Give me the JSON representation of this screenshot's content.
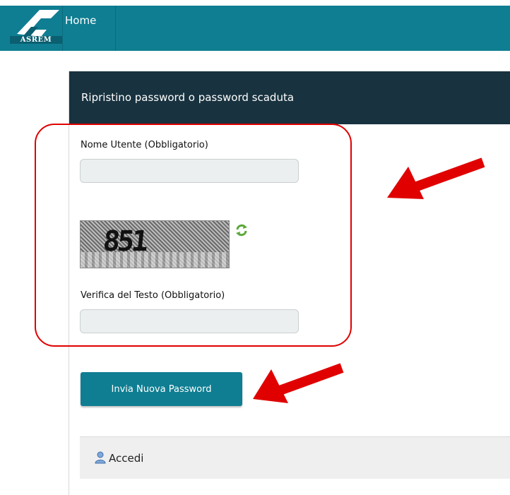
{
  "header": {
    "logo_text": "ASREM",
    "nav_home": "Home"
  },
  "panel": {
    "title": "Ripristino password o password scaduta"
  },
  "form": {
    "username_label": "Nome Utente (Obbligatorio)",
    "username_value": "",
    "captcha_text": "851",
    "verify_label": "Verifica del Testo (Obbligatorio)",
    "verify_value": "",
    "submit_label": "Invia Nuova Password"
  },
  "footer": {
    "login_label": "Accedi"
  },
  "colors": {
    "teal": "#0f7e92",
    "dark_header": "#18323f",
    "annotation_red": "#e00000"
  },
  "icons": {
    "logo": "asrem-logo-icon",
    "refresh": "refresh-icon",
    "user": "user-icon",
    "arrow": "red-arrow-icon"
  }
}
